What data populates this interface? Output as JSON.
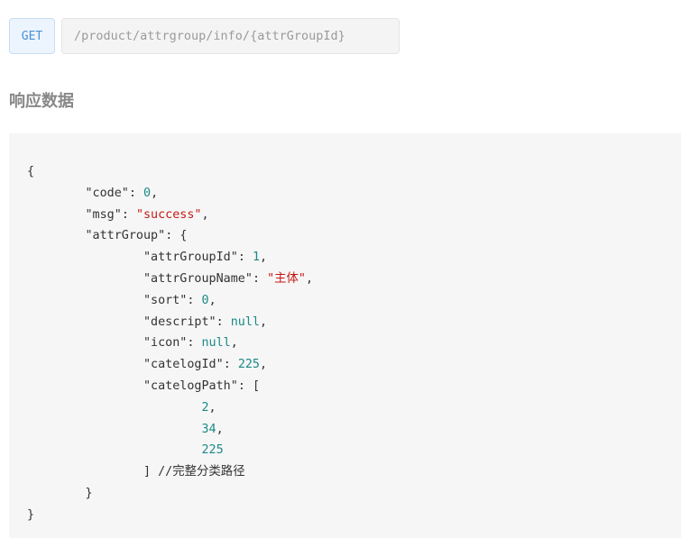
{
  "endpoint": {
    "method": "GET",
    "path": "/product/attrgroup/info/{attrGroupId}"
  },
  "section": {
    "title": "响应数据"
  },
  "response": {
    "open_brace": "{",
    "code_key": "\"code\"",
    "code_value": "0",
    "msg_key": "\"msg\"",
    "msg_value": "\"success\"",
    "attrGroup_key": "\"attrGroup\"",
    "attrGroup_open": "{",
    "attrGroupId_key": "\"attrGroupId\"",
    "attrGroupId_value": "1",
    "attrGroupName_key": "\"attrGroupName\"",
    "attrGroupName_value": "\"主体\"",
    "sort_key": "\"sort\"",
    "sort_value": "0",
    "descript_key": "\"descript\"",
    "descript_value": "null",
    "icon_key": "\"icon\"",
    "icon_value": "null",
    "catelogId_key": "\"catelogId\"",
    "catelogId_value": "225",
    "catelogPath_key": "\"catelogPath\"",
    "catelogPath_open": "[",
    "catelogPath_values": [
      "2",
      "34",
      "225"
    ],
    "catelogPath_close": "]",
    "catelogPath_comment": "//完整分类路径",
    "attrGroup_close": "}",
    "close_brace": "}"
  }
}
